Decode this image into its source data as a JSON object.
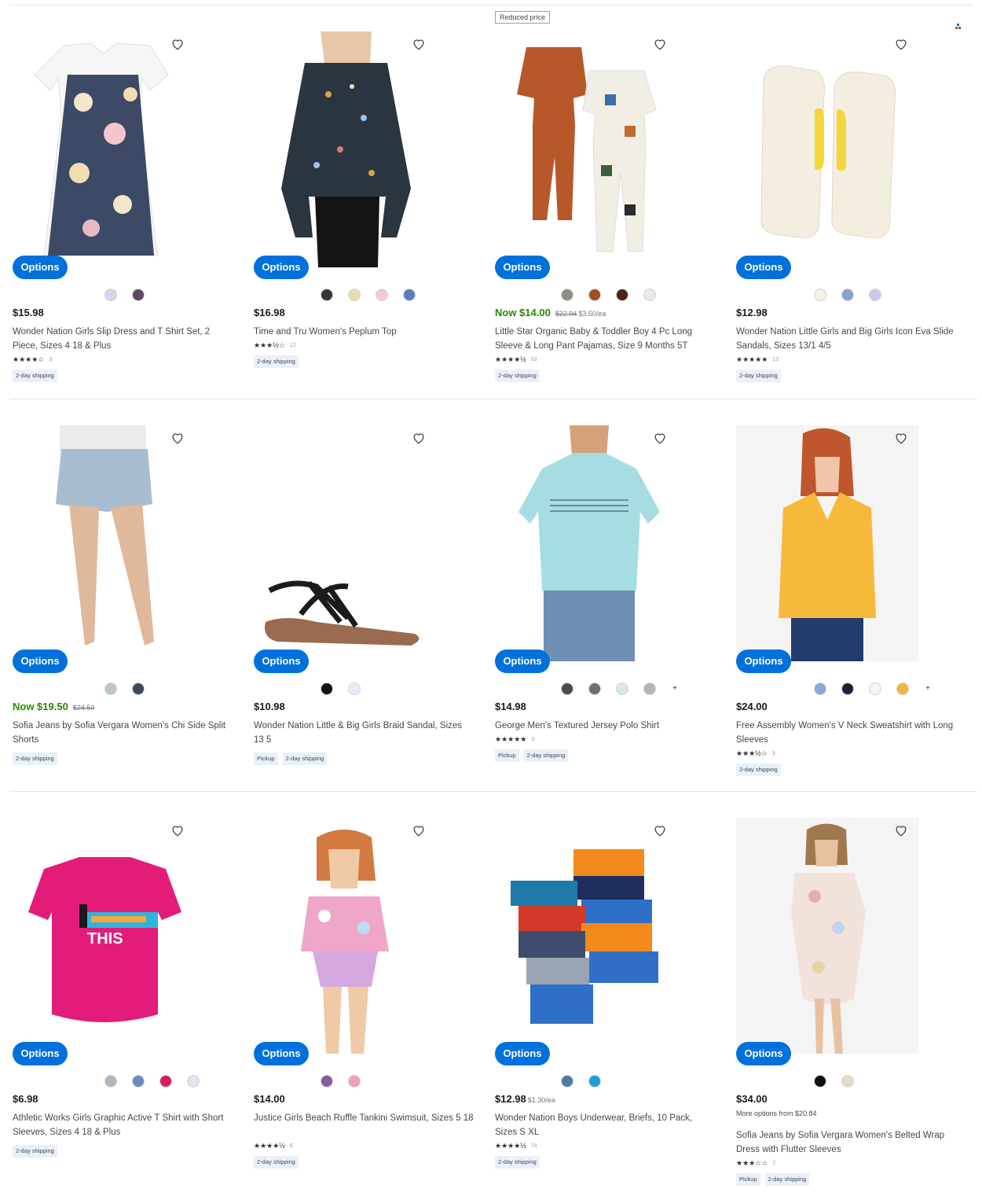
{
  "header": {
    "reduced_price_tag": "Reduced price"
  },
  "ui": {
    "options_label": "Options"
  },
  "products": [
    {
      "price": "$15.98",
      "price_now": false,
      "was_price": "",
      "unit_price": "",
      "more_options": "",
      "title": "Wonder Nation Girls Slip Dress and T Shirt Set, 2 Piece, Sizes 4 18 & Plus",
      "stars": "★★★★☆",
      "rating_count": "3",
      "badges": [
        "2-day shipping"
      ],
      "swatches": [
        "#d8d2ec",
        "#5c4a5e"
      ]
    },
    {
      "price": "$16.98",
      "price_now": false,
      "was_price": "",
      "unit_price": "",
      "more_options": "",
      "title": "Time and Tru Women's Peplum Top",
      "stars": "★★★½☆",
      "rating_count": "12",
      "badges": [
        "2-day shipping"
      ],
      "swatches": [
        "#3a3530",
        "#e8dcae",
        "#f5c9d3",
        "#5b7fbc"
      ]
    },
    {
      "price": "Now $14.00",
      "price_now": true,
      "was_price": "$22.94",
      "unit_price": "$3.50/ea",
      "more_options": "",
      "title": "Little Star Organic Baby & Toddler Boy 4 Pc Long Sleeve & Long Pant Pajamas, Size 9 Months  5T",
      "stars": "★★★★½",
      "rating_count": "53",
      "badges": [
        "2-day shipping"
      ],
      "swatches": [
        "#8d8d86",
        "#a44f22",
        "#4a2518",
        "#e9e9e9"
      ]
    },
    {
      "price": "$12.98",
      "price_now": false,
      "was_price": "",
      "unit_price": "",
      "more_options": "",
      "title": "Wonder Nation Little Girls and Big Girls Icon Eva Slide Sandals, Sizes 13/1  4/5",
      "stars": "★★★★★",
      "rating_count": "13",
      "badges": [
        "2-day shipping"
      ],
      "swatches": [
        "#f7f1e2",
        "#8a9fd2",
        "#c8c8f0"
      ]
    },
    {
      "price": "Now $19.50",
      "price_now": true,
      "was_price": "$24.50",
      "unit_price": "",
      "more_options": "",
      "title": "Sofia Jeans by Sofia Vergara Women's Chi Side Split Shorts",
      "stars": "",
      "rating_count": "",
      "badges": [
        "2-day shipping"
      ],
      "swatches": [
        "#b8c6d1",
        "#3c4a60"
      ]
    },
    {
      "price": "$10.98",
      "price_now": false,
      "was_price": "",
      "unit_price": "",
      "more_options": "",
      "title": "Wonder Nation Little & Big Girls Braid Sandal, Sizes 13 5",
      "stars": "",
      "rating_count": "",
      "badges": [
        "Pickup",
        "2-day shipping"
      ],
      "swatches": [
        "#111111",
        "#e4eef8"
      ]
    },
    {
      "price": "$14.98",
      "price_now": false,
      "was_price": "",
      "unit_price": "",
      "more_options": "",
      "title": "George Men's Textured Jersey Polo Shirt",
      "stars": "★★★★★",
      "rating_count": "3",
      "badges": [
        "Pickup",
        "2-day shipping"
      ],
      "swatches": [
        "#4a4a4a",
        "#6e6e6e",
        "#d6e6ef",
        "#b5b5b5",
        "+"
      ]
    },
    {
      "price": "$24.00",
      "price_now": false,
      "was_price": "",
      "unit_price": "",
      "more_options": "",
      "title": "Free Assembly Women's V Neck Sweatshirt with Long Sleeves",
      "stars": "★★★½☆",
      "rating_count": "3",
      "badges": [
        "2-day shipping"
      ],
      "swatches": [
        "#87a9dd",
        "#1c2238",
        "#f4f4f4",
        "#f0b53a",
        "+"
      ]
    },
    {
      "price": "$6.98",
      "price_now": false,
      "was_price": "",
      "unit_price": "",
      "more_options": "",
      "title": "Athletic Works Girls Graphic Active T Shirt with Short Sleeves, Sizes 4 18 & Plus",
      "stars": "",
      "rating_count": "",
      "badges": [
        "2-day shipping"
      ],
      "swatches": [
        "#adb5bd",
        "#7088c4",
        "#d91b5c",
        "#dfe6ee"
      ]
    },
    {
      "price": "$14.00",
      "price_now": false,
      "was_price": "",
      "unit_price": "",
      "more_options": "",
      "title": "Justice Girls Beach Ruffle Tankini Swimsuit, Sizes 5 18",
      "stars": "★★★★½",
      "rating_count": "6",
      "badges": [
        "2-day shipping"
      ],
      "swatches": [
        "#8a5aa0",
        "#f0a0b8"
      ]
    },
    {
      "price": "$12.98",
      "price_now": false,
      "was_price": "",
      "unit_price": "$1.30/ea",
      "more_options": "",
      "title": "Wonder Nation Boys Underwear, Briefs, 10 Pack, Sizes S XL",
      "stars": "★★★★½",
      "rating_count": "74",
      "badges": [
        "2-day shipping"
      ],
      "swatches": [
        "#4a7aa8",
        "#1a9fd6"
      ]
    },
    {
      "price": "$34.00",
      "price_now": false,
      "was_price": "",
      "unit_price": "",
      "more_options": "More options from $20.84",
      "title": "Sofia Jeans by Sofia Vergara Women's Belted Wrap Dress with Flutter Sleeves",
      "stars": "★★★☆☆",
      "rating_count": "2",
      "badges": [
        "Pickup",
        "2-day shipping"
      ],
      "swatches": [
        "#111111",
        "#e8d8c4"
      ]
    }
  ]
}
